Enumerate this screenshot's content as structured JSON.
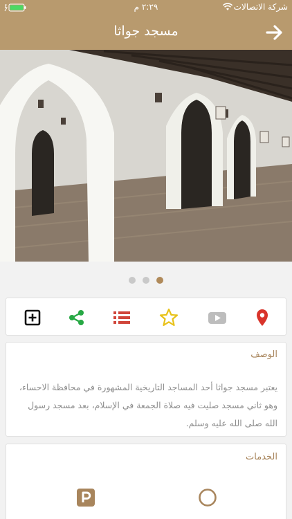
{
  "status_bar": {
    "carrier": "شركة الاتصالات",
    "time": "٢:٢٩ م"
  },
  "header": {
    "title": "مسجد جواثا",
    "back_icon": "arrow-right-icon"
  },
  "gallery": {
    "image": "mosque-interior-photo",
    "page_count": 3,
    "active_page": 3
  },
  "actions": [
    {
      "icon": "add-box-icon",
      "color": "#111111"
    },
    {
      "icon": "share-icon",
      "color": "#27a844"
    },
    {
      "icon": "list-icon",
      "color": "#d0453a"
    },
    {
      "icon": "star-icon",
      "color": "#e8c21a"
    },
    {
      "icon": "youtube-icon",
      "color": "#bdbdbd"
    },
    {
      "icon": "location-pin-icon",
      "color": "#d9342b"
    }
  ],
  "description": {
    "title": "الوصف",
    "text": "يعتبر مسجد جواثا أحد المساجد التاريخية المشهورة في محافظة الاحساء، وهو ثاني مسجد صليت فيه صلاة الجمعة في الإسلام، بعد مسجد رسول الله صلى الله عليه وسلم."
  },
  "services": {
    "title": "الخدمات",
    "items": [
      {
        "icon": "parking-icon"
      },
      {
        "icon": "circle-icon"
      }
    ]
  },
  "colors": {
    "brand": "#b89a6e",
    "accent_text": "#a8855c",
    "body_text": "#8e8e8e"
  }
}
